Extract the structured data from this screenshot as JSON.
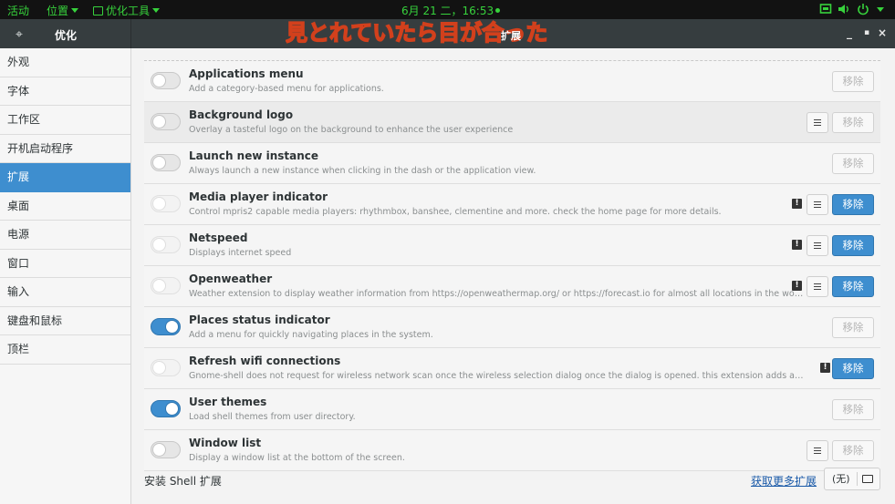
{
  "topbar": {
    "activities": "活动",
    "places": "位置",
    "app_menu": "优化工具",
    "clock": "6月 21 二，16:53"
  },
  "header": {
    "app_title": "优化",
    "page_title": "扩展",
    "overlay_text": "見とれていたら目が合った"
  },
  "sidebar": {
    "items": [
      {
        "label": "外观"
      },
      {
        "label": "字体"
      },
      {
        "label": "工作区"
      },
      {
        "label": "开机启动程序"
      },
      {
        "label": "扩展",
        "active": true
      },
      {
        "label": "桌面"
      },
      {
        "label": "电源"
      },
      {
        "label": "窗口"
      },
      {
        "label": "输入"
      },
      {
        "label": "键盘和鼠标"
      },
      {
        "label": "顶栏"
      }
    ]
  },
  "remove_label": "移除",
  "extensions": [
    {
      "name": "Applications menu",
      "desc": "Add a category-based menu for applications.",
      "enabled": false,
      "settings": false,
      "warning": false,
      "remove_active": false
    },
    {
      "name": "Background logo",
      "desc": "Overlay a tasteful logo on the background to enhance the user experience",
      "enabled": false,
      "settings": true,
      "warning": false,
      "remove_active": false
    },
    {
      "name": "Launch new instance",
      "desc": "Always launch a new instance when clicking in the dash or the application view.",
      "enabled": false,
      "settings": false,
      "warning": false,
      "remove_active": false
    },
    {
      "name": "Media player indicator",
      "desc": "Control mpris2 capable media players: rhythmbox, banshee, clementine and more. check the home page for more details.",
      "enabled": false,
      "settings": true,
      "warning": true,
      "remove_active": true
    },
    {
      "name": "Netspeed",
      "desc": "Displays internet speed",
      "enabled": false,
      "settings": true,
      "warning": true,
      "remove_active": true
    },
    {
      "name": "Openweather",
      "desc": "Weather extension to display weather information from https://openweathermap.org/ or https://forecast.io for almost all locations in the world.",
      "enabled": false,
      "settings": true,
      "warning": true,
      "remove_active": true
    },
    {
      "name": "Places status indicator",
      "desc": "Add a menu for quickly navigating places in the system.",
      "enabled": true,
      "settings": false,
      "warning": false,
      "remove_active": false
    },
    {
      "name": "Refresh wifi connections",
      "desc": "Gnome-shell does not request for wireless network scan once the wireless selection dialog once the dialog is opened. this extension adds a refresh button to the wireless selection dialog.",
      "enabled": false,
      "settings": false,
      "warning": true,
      "remove_active": true
    },
    {
      "name": "User themes",
      "desc": "Load shell themes from user directory.",
      "enabled": true,
      "settings": false,
      "warning": false,
      "remove_active": false
    },
    {
      "name": "Window list",
      "desc": "Display a window list at the bottom of the screen.",
      "enabled": false,
      "settings": true,
      "warning": false,
      "remove_active": false
    }
  ],
  "footer": {
    "install_label": "安装 Shell 扩展",
    "more_link": "获取更多扩展",
    "file_button": "(无)"
  },
  "colors": {
    "accent": "#3e8ecf",
    "topbar_text": "#37d23c"
  }
}
